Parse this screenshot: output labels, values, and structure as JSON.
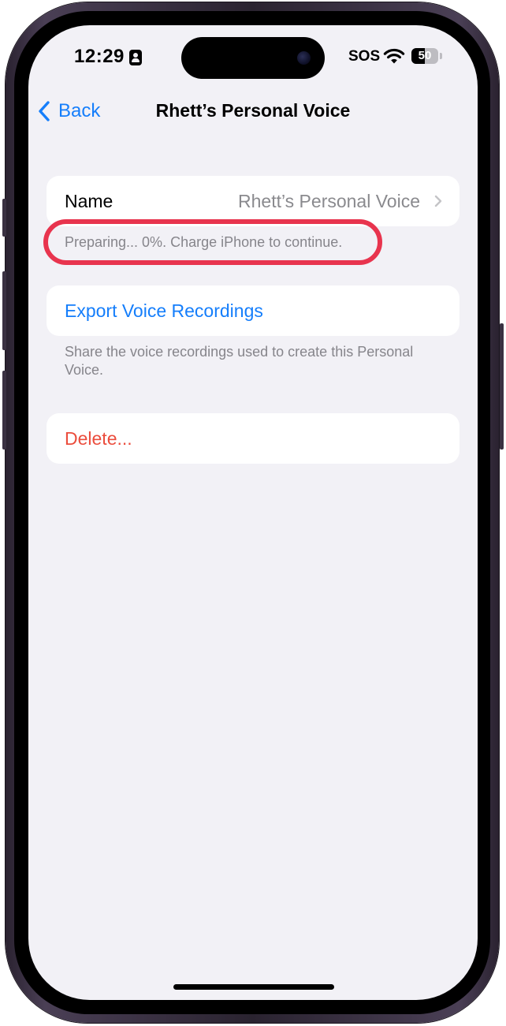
{
  "status_bar": {
    "time": "12:29",
    "carrier": "SOS",
    "battery_level": 50,
    "battery_text": "50",
    "icons": [
      "focus-person-icon",
      "wifi-icon",
      "battery-icon"
    ]
  },
  "nav": {
    "back_label": "Back",
    "title": "Rhett’s Personal Voice"
  },
  "name_section": {
    "label": "Name",
    "value": "Rhett’s Personal Voice",
    "status_footer": "Preparing... 0%. Charge iPhone to continue."
  },
  "export_section": {
    "action_label": "Export Voice Recordings",
    "footer": "Share the voice recordings used to create this Personal Voice."
  },
  "delete_section": {
    "action_label": "Delete..."
  },
  "colors": {
    "accent_blue": "#157efb",
    "destructive_red": "#eb4d3d",
    "highlight_ring": "#e8344e",
    "background": "#f2f1f6"
  }
}
